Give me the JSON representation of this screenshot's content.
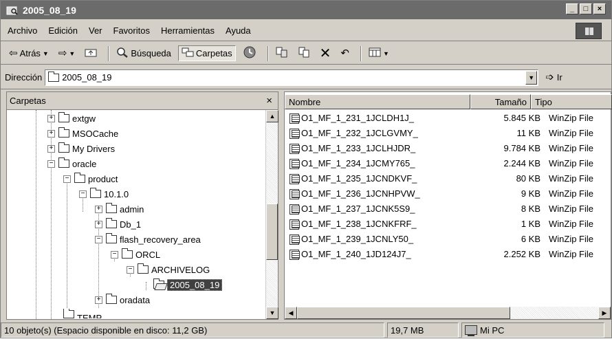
{
  "window": {
    "title": "2005_08_19"
  },
  "menubar": {
    "items": [
      "Archivo",
      "Edición",
      "Ver",
      "Favoritos",
      "Herramientas",
      "Ayuda"
    ]
  },
  "toolbar": {
    "back_label": "Atrás",
    "search_label": "Búsqueda",
    "folders_label": "Carpetas"
  },
  "address": {
    "label": "Dirección",
    "value": "2005_08_19",
    "go_label": "Ir"
  },
  "folders_pane": {
    "title": "Carpetas",
    "close_glyph": "×",
    "items": [
      "extgw",
      "MSOCache",
      "My Drivers",
      "oracle",
      "product",
      "10.1.0",
      "admin",
      "Db_1",
      "flash_recovery_area",
      "ORCL",
      "ARCHIVELOG",
      "2005_08_19",
      "oradata",
      "TEMP"
    ]
  },
  "files_pane": {
    "columns": {
      "name": "Nombre",
      "size": "Tamaño",
      "type": "Tipo"
    },
    "rows": [
      {
        "name": "O1_MF_1_231_1JCLDH1J_",
        "size": "5.845 KB",
        "type": "WinZip File"
      },
      {
        "name": "O1_MF_1_232_1JCLGVMY_",
        "size": "11 KB",
        "type": "WinZip File"
      },
      {
        "name": "O1_MF_1_233_1JCLHJDR_",
        "size": "9.784 KB",
        "type": "WinZip File"
      },
      {
        "name": "O1_MF_1_234_1JCMY765_",
        "size": "2.244 KB",
        "type": "WinZip File"
      },
      {
        "name": "O1_MF_1_235_1JCNDKVF_",
        "size": "80 KB",
        "type": "WinZip File"
      },
      {
        "name": "O1_MF_1_236_1JCNHPVW_",
        "size": "9 KB",
        "type": "WinZip File"
      },
      {
        "name": "O1_MF_1_237_1JCNK5S9_",
        "size": "8 KB",
        "type": "WinZip File"
      },
      {
        "name": "O1_MF_1_238_1JCNKFRF_",
        "size": "1 KB",
        "type": "WinZip File"
      },
      {
        "name": "O1_MF_1_239_1JCNLY50_",
        "size": "6 KB",
        "type": "WinZip File"
      },
      {
        "name": "O1_MF_1_240_1JD124J7_",
        "size": "2.252 KB",
        "type": "WinZip File"
      }
    ]
  },
  "status": {
    "objects": "10 objeto(s) (Espacio disponible en disco: 11,2 GB)",
    "size": "19,7 MB",
    "location": "Mi PC"
  }
}
